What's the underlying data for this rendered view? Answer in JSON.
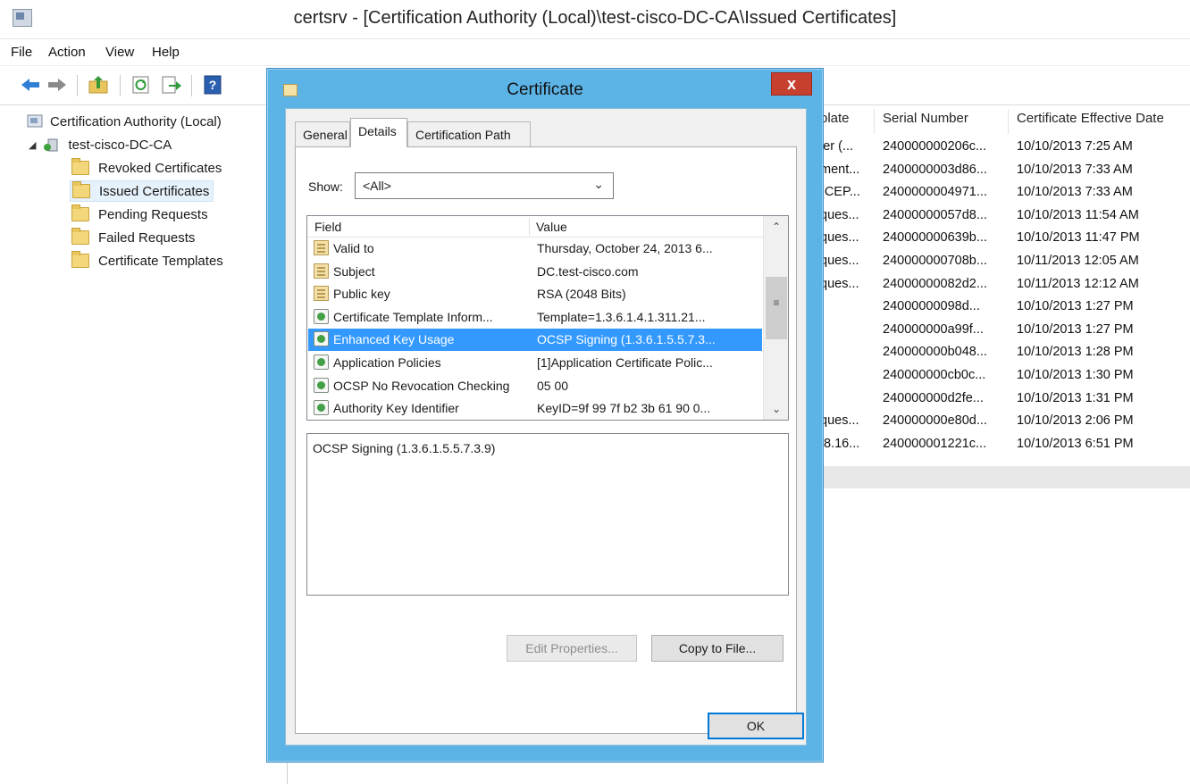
{
  "window": {
    "title": "certsrv - [Certification Authority (Local)\\test-cisco-DC-CA\\Issued Certificates]"
  },
  "menu": {
    "file": "File",
    "action": "Action",
    "view": "View",
    "help": "Help"
  },
  "toolbar": {
    "icons": [
      "back-arrow-icon",
      "forward-arrow-icon",
      "up-folder-icon",
      "refresh-icon",
      "export-list-icon",
      "help-icon"
    ]
  },
  "tree": {
    "root": "Certification Authority (Local)",
    "ca": "test-cisco-DC-CA",
    "items": [
      "Revoked Certificates",
      "Issued Certificates",
      "Pending Requests",
      "Failed Requests",
      "Certificate Templates"
    ],
    "selected": "Issued Certificates"
  },
  "list": {
    "headers": [
      "plate",
      "Serial Number",
      "Certificate Effective Date"
    ],
    "rows": [
      [
        "ler (...",
        "240000000206c...",
        "10/10/2013 7:25 AM"
      ],
      [
        "ment...",
        "2400000003d86...",
        "10/10/2013 7:33 AM"
      ],
      [
        "(CEP...",
        "2400000004971...",
        "10/10/2013 7:33 AM"
      ],
      [
        "ques...",
        "24000000057d8...",
        "10/10/2013 11:54 AM"
      ],
      [
        "ques...",
        "240000000639b...",
        "10/10/2013 11:47 PM"
      ],
      [
        "ques...",
        "240000000708b...",
        "10/11/2013 12:05 AM"
      ],
      [
        "ques...",
        "24000000082d2...",
        "10/11/2013 12:12 AM"
      ],
      [
        "",
        "24000000098d...",
        "10/10/2013 1:27 PM"
      ],
      [
        "",
        "240000000a99f...",
        "10/10/2013 1:27 PM"
      ],
      [
        "",
        "240000000b048...",
        "10/10/2013 1:28 PM"
      ],
      [
        "",
        "240000000cb0c...",
        "10/10/2013 1:30 PM"
      ],
      [
        "",
        "240000000d2fe...",
        "10/10/2013 1:31 PM"
      ],
      [
        "ques...",
        "240000000e80d...",
        "10/10/2013 2:06 PM"
      ],
      [
        ".8.16...",
        "240000001221c...",
        "10/10/2013 6:51 PM"
      ]
    ]
  },
  "dialog": {
    "title": "Certificate",
    "close": "x",
    "tabs": [
      "General",
      "Details",
      "Certification Path"
    ],
    "active_tab": "Details",
    "show_label": "Show:",
    "show_value": "<All>",
    "field_header": "Field",
    "value_header": "Value",
    "fields": [
      {
        "field": "Valid to",
        "value": "Thursday, October 24, 2013 6...",
        "icon": "document-icon"
      },
      {
        "field": "Subject",
        "value": "DC.test-cisco.com",
        "icon": "document-icon"
      },
      {
        "field": "Public key",
        "value": "RSA (2048 Bits)",
        "icon": "document-icon"
      },
      {
        "field": "Certificate Template Inform...",
        "value": "Template=1.3.6.1.4.1.311.21...",
        "icon": "extension-icon"
      },
      {
        "field": "Enhanced Key Usage",
        "value": "OCSP Signing (1.3.6.1.5.5.7.3...",
        "icon": "extension-icon"
      },
      {
        "field": "Application Policies",
        "value": "[1]Application Certificate Polic...",
        "icon": "extension-icon"
      },
      {
        "field": "OCSP No Revocation Checking",
        "value": "05 00",
        "icon": "extension-icon"
      },
      {
        "field": "Authority Key Identifier",
        "value": "KeyID=9f 99 7f b2 3b 61 90 0...",
        "icon": "extension-icon"
      }
    ],
    "selected_field": "Enhanced Key Usage",
    "detail_value": "OCSP Signing (1.3.6.1.5.5.7.3.9)",
    "edit_properties": "Edit Properties...",
    "copy_to_file": "Copy to File...",
    "ok": "OK"
  }
}
